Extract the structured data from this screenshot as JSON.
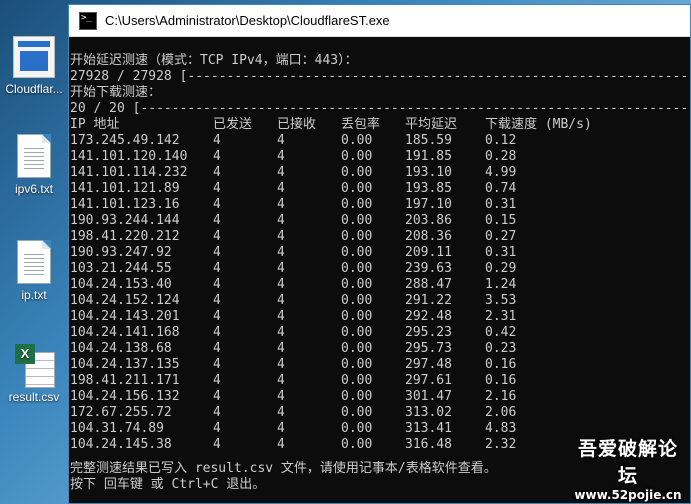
{
  "desktop": {
    "icons": [
      {
        "label": "Cloudflar..."
      },
      {
        "label": "ipv6.txt"
      },
      {
        "label": "ip.txt"
      },
      {
        "label": "result.csv"
      }
    ]
  },
  "window": {
    "title": "C:\\Users\\Administrator\\Desktop\\CloudflareST.exe"
  },
  "console": {
    "latency_header": "开始延迟测速（模式：TCP IPv4，端口：443）：",
    "latency_progress": "27928 / 27928 [------------------------------------------------------------------------------------",
    "download_header": "开始下载测速：",
    "download_progress": "20 / 20 [-------------------------------------------------------------------------------------------",
    "columns": [
      "IP 地址",
      "已发送",
      "已接收",
      "丢包率",
      "平均延迟",
      "下载速度 (MB/s)"
    ],
    "rows": [
      {
        "ip": "173.245.49.142",
        "sent": "4",
        "recv": "4",
        "loss": "0.00",
        "latency": "185.59",
        "speed": "0.12"
      },
      {
        "ip": "141.101.120.140",
        "sent": "4",
        "recv": "4",
        "loss": "0.00",
        "latency": "191.85",
        "speed": "0.28"
      },
      {
        "ip": "141.101.114.232",
        "sent": "4",
        "recv": "4",
        "loss": "0.00",
        "latency": "193.10",
        "speed": "4.99"
      },
      {
        "ip": "141.101.121.89",
        "sent": "4",
        "recv": "4",
        "loss": "0.00",
        "latency": "193.85",
        "speed": "0.74"
      },
      {
        "ip": "141.101.123.16",
        "sent": "4",
        "recv": "4",
        "loss": "0.00",
        "latency": "197.10",
        "speed": "0.31"
      },
      {
        "ip": "190.93.244.144",
        "sent": "4",
        "recv": "4",
        "loss": "0.00",
        "latency": "203.86",
        "speed": "0.15"
      },
      {
        "ip": "198.41.220.212",
        "sent": "4",
        "recv": "4",
        "loss": "0.00",
        "latency": "208.36",
        "speed": "0.27"
      },
      {
        "ip": "190.93.247.92",
        "sent": "4",
        "recv": "4",
        "loss": "0.00",
        "latency": "209.11",
        "speed": "0.31"
      },
      {
        "ip": "103.21.244.55",
        "sent": "4",
        "recv": "4",
        "loss": "0.00",
        "latency": "239.63",
        "speed": "0.29"
      },
      {
        "ip": "104.24.153.40",
        "sent": "4",
        "recv": "4",
        "loss": "0.00",
        "latency": "288.47",
        "speed": "1.24"
      },
      {
        "ip": "104.24.152.124",
        "sent": "4",
        "recv": "4",
        "loss": "0.00",
        "latency": "291.22",
        "speed": "3.53"
      },
      {
        "ip": "104.24.143.201",
        "sent": "4",
        "recv": "4",
        "loss": "0.00",
        "latency": "292.48",
        "speed": "2.31"
      },
      {
        "ip": "104.24.141.168",
        "sent": "4",
        "recv": "4",
        "loss": "0.00",
        "latency": "295.23",
        "speed": "0.42"
      },
      {
        "ip": "104.24.138.68",
        "sent": "4",
        "recv": "4",
        "loss": "0.00",
        "latency": "295.73",
        "speed": "0.23"
      },
      {
        "ip": "104.24.137.135",
        "sent": "4",
        "recv": "4",
        "loss": "0.00",
        "latency": "297.48",
        "speed": "0.16"
      },
      {
        "ip": "198.41.211.171",
        "sent": "4",
        "recv": "4",
        "loss": "0.00",
        "latency": "297.61",
        "speed": "0.16"
      },
      {
        "ip": "104.24.156.132",
        "sent": "4",
        "recv": "4",
        "loss": "0.00",
        "latency": "301.47",
        "speed": "2.16"
      },
      {
        "ip": "172.67.255.72",
        "sent": "4",
        "recv": "4",
        "loss": "0.00",
        "latency": "313.02",
        "speed": "2.06"
      },
      {
        "ip": "104.31.74.89",
        "sent": "4",
        "recv": "4",
        "loss": "0.00",
        "latency": "313.41",
        "speed": "4.83"
      },
      {
        "ip": "104.24.145.38",
        "sent": "4",
        "recv": "4",
        "loss": "0.00",
        "latency": "316.48",
        "speed": "2.32"
      }
    ],
    "footer_line1": "完整测速结果已写入 result.csv 文件，请使用记事本/表格软件查看。",
    "footer_line2": "按下 回车键 或 Ctrl+C 退出。"
  },
  "watermark": {
    "line1": "吾爱破解论坛",
    "line2": "www.52pojie.cn"
  }
}
